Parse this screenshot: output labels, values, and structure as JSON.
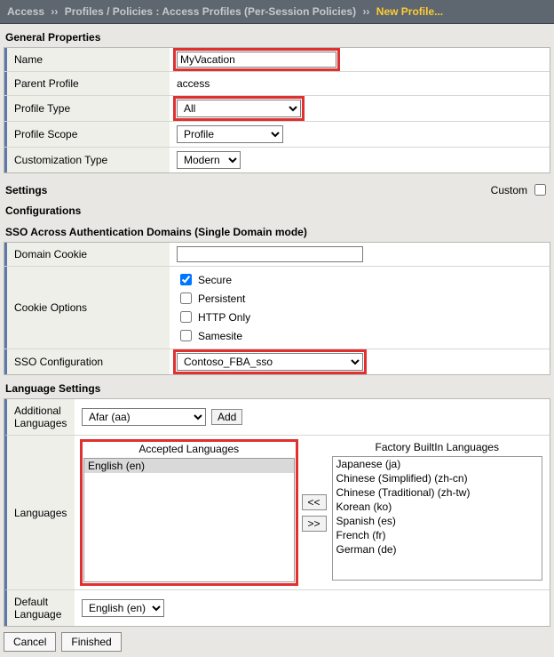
{
  "breadcrumb": {
    "root": "Access",
    "mid": "Profiles / Policies : Access Profiles (Per-Session Policies)",
    "leaf": "New Profile..."
  },
  "sections": {
    "general": "General Properties",
    "settings": "Settings",
    "custom_label": "Custom",
    "configurations": "Configurations",
    "sso": "SSO Across Authentication Domains (Single Domain mode)",
    "lang": "Language Settings"
  },
  "general": {
    "name_label": "Name",
    "name_value": "MyVacation",
    "parent_label": "Parent Profile",
    "parent_value": "access",
    "type_label": "Profile Type",
    "type_value": "All",
    "scope_label": "Profile Scope",
    "scope_value": "Profile",
    "cust_label": "Customization Type",
    "cust_value": "Modern"
  },
  "sso": {
    "domain_cookie_label": "Domain Cookie",
    "domain_cookie_value": "",
    "cookie_opts_label": "Cookie Options",
    "opt_secure": "Secure",
    "opt_persistent": "Persistent",
    "opt_httponly": "HTTP Only",
    "opt_samesite": "Samesite",
    "sso_config_label": "SSO Configuration",
    "sso_config_value": "Contoso_FBA_sso"
  },
  "lang": {
    "additional_label": "Additional Languages",
    "additional_value": "Afar (aa)",
    "add_btn": "Add",
    "languages_label": "Languages",
    "accepted_title": "Accepted Languages",
    "factory_title": "Factory BuiltIn Languages",
    "accepted": [
      "English (en)"
    ],
    "factory": [
      "Japanese (ja)",
      "Chinese (Simplified) (zh-cn)",
      "Chinese (Traditional) (zh-tw)",
      "Korean (ko)",
      "Spanish (es)",
      "French (fr)",
      "German (de)"
    ],
    "move_left": "<<",
    "move_right": ">>",
    "default_label": "Default Language",
    "default_value": "English (en)"
  },
  "footer": {
    "cancel": "Cancel",
    "finished": "Finished"
  }
}
